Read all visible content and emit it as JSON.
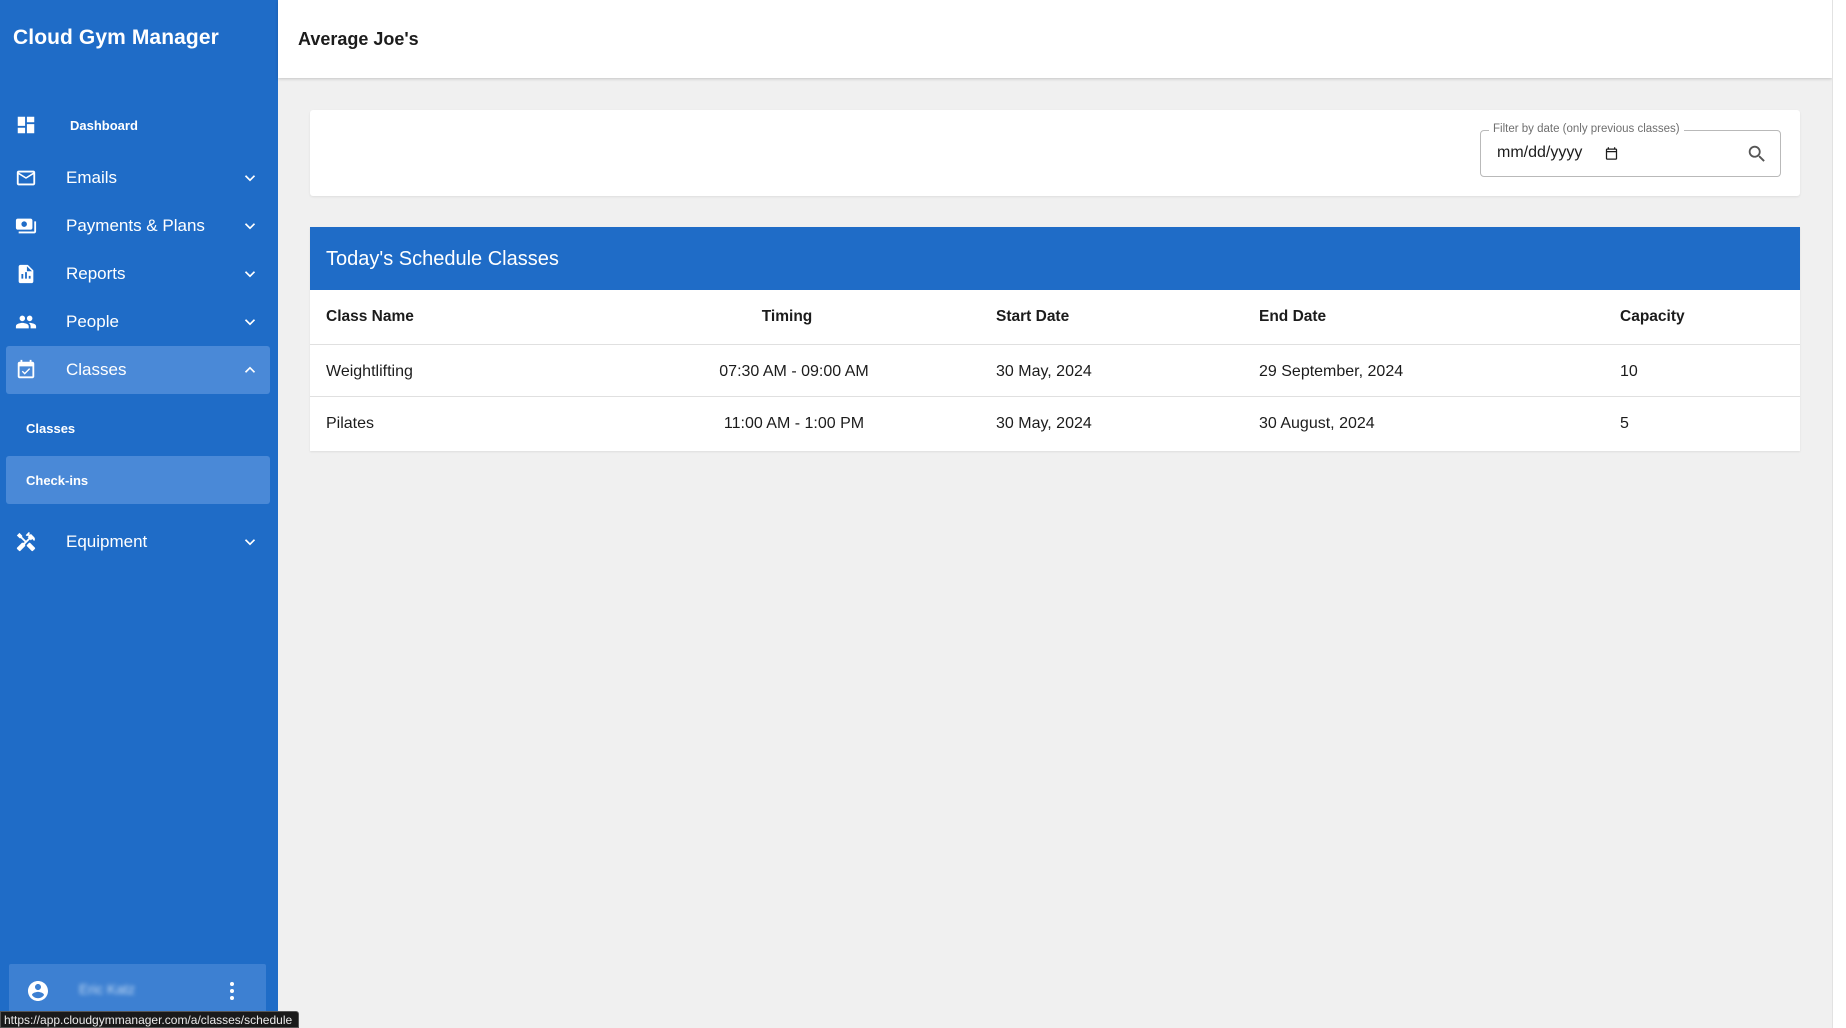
{
  "sidebar": {
    "brand": "Cloud Gym Manager",
    "items": [
      {
        "label": "Dashboard",
        "icon": "dashboard-icon"
      },
      {
        "label": "Emails",
        "icon": "mail-icon"
      },
      {
        "label": "Payments & Plans",
        "icon": "payments-icon"
      },
      {
        "label": "Reports",
        "icon": "reports-icon"
      },
      {
        "label": "People",
        "icon": "people-icon"
      },
      {
        "label": "Classes",
        "icon": "calendar-check-icon"
      },
      {
        "label": "Equipment",
        "icon": "tools-icon"
      }
    ],
    "sub_items": [
      {
        "label": "Classes"
      },
      {
        "label": "Check-ins"
      }
    ],
    "user": {
      "name": "Eric Katz"
    }
  },
  "status_bar": {
    "url": "https://app.cloudgymmanager.com/a/classes/schedule"
  },
  "header": {
    "title": "Average Joe's"
  },
  "filter": {
    "label": "Filter by date (only previous classes)",
    "value": "mm/dd/yyyy"
  },
  "schedule": {
    "title": "Today's Schedule Classes",
    "columns": [
      "Class Name",
      "Timing",
      "Start Date",
      "End Date",
      "Capacity"
    ],
    "rows": [
      [
        "Weightlifting",
        "07:30 AM - 09:00 AM",
        "30 May, 2024",
        "29 September, 2024",
        "10"
      ],
      [
        "Pilates",
        "11:00 AM - 1:00 PM",
        "30 May, 2024",
        "30 August, 2024",
        "5"
      ]
    ]
  },
  "colors": {
    "sidebar": "#1f6cc7",
    "active_item": "#4a89d7",
    "background": "#f0f0f0"
  }
}
